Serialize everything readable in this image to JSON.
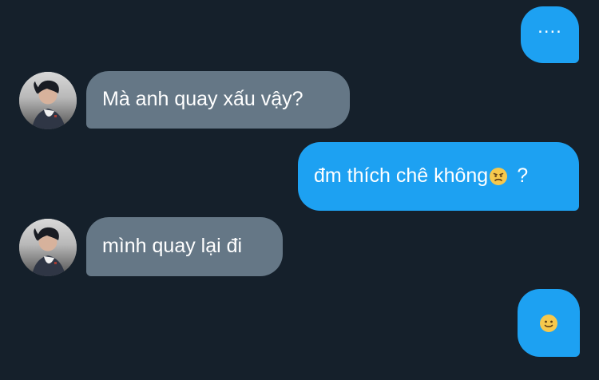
{
  "messages": [
    {
      "direction": "outgoing",
      "text": "...."
    },
    {
      "direction": "incoming",
      "text": "Mà anh quay xấu vậy?"
    },
    {
      "direction": "outgoing",
      "text": "đm thích chê không",
      "emoji": "angry-face-icon",
      "suffix": " ?"
    },
    {
      "direction": "incoming",
      "text": "mình quay lại đi"
    },
    {
      "direction": "outgoing",
      "emoji": "slightly-smiling-face-icon"
    }
  ],
  "colors": {
    "background": "#15202b",
    "outgoing_bubble": "#1da1f2",
    "incoming_bubble": "#657786",
    "text": "#ffffff"
  }
}
